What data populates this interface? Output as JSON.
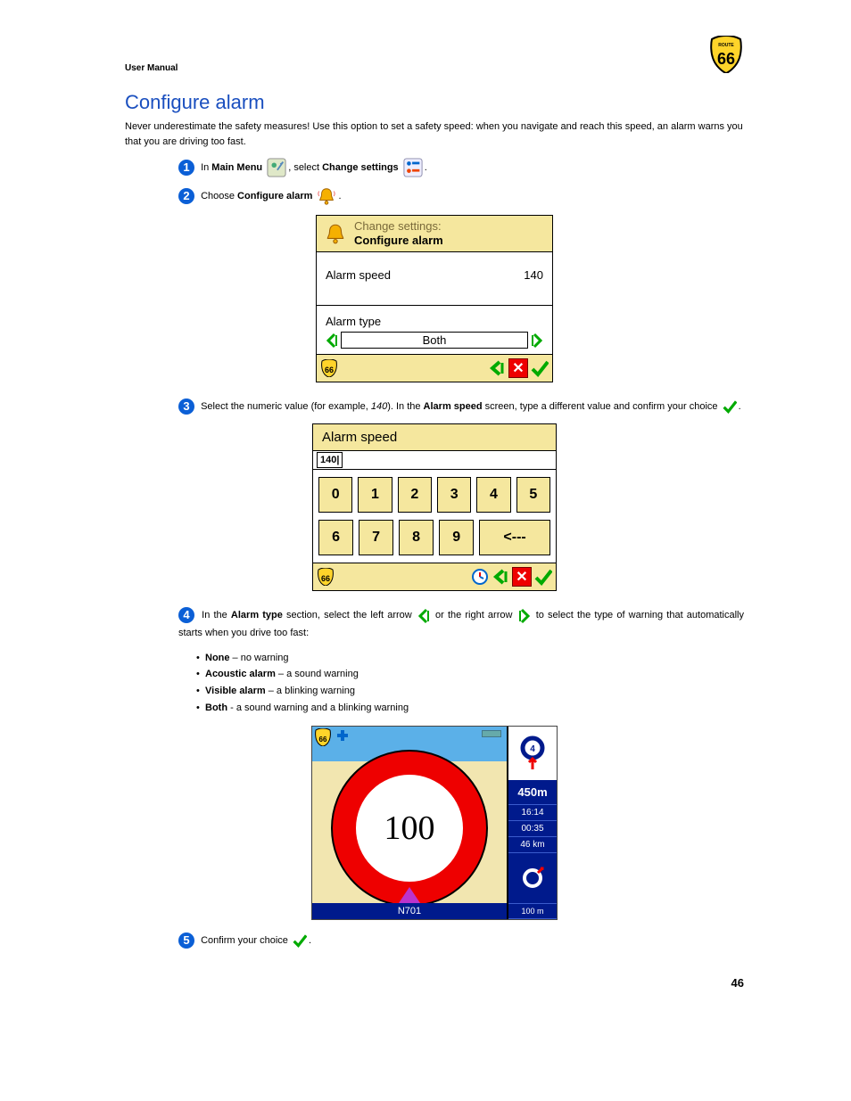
{
  "header": {
    "manual": "User Manual"
  },
  "title": "Configure alarm",
  "intro": "Never underestimate the safety measures! Use this option to set a safety speed: when you navigate and reach this speed, an alarm warns you that you are driving too fast.",
  "steps": {
    "s1": {
      "num": "1",
      "pre": "In ",
      "b1": "Main Menu",
      "mid": ", select ",
      "b2": "Change settings",
      "post": "."
    },
    "s2": {
      "num": "2",
      "pre": "Choose ",
      "b1": "Configure alarm",
      "post": "."
    },
    "s3": {
      "num": "3",
      "pre": "Select the numeric value (for example, ",
      "i1": "140",
      "mid": "). In the ",
      "b1": "Alarm speed",
      "post1": " screen, type a different value and confirm your choice ",
      "post2": "."
    },
    "s4": {
      "num": "4",
      "pre": "In the ",
      "b1": "Alarm type",
      "mid1": " section, select the left arrow ",
      "mid2": " or the right arrow ",
      "post": " to select the type of warning that automatically starts when you drive too fast:"
    },
    "s5": {
      "num": "5",
      "pre": "Confirm your choice ",
      "post": "."
    }
  },
  "bullets": [
    {
      "b": "None",
      "t": " – no warning"
    },
    {
      "b": "Acoustic alarm",
      "t": " – a sound warning"
    },
    {
      "b": "Visible alarm",
      "t": " – a blinking warning"
    },
    {
      "b": "Both",
      "t": " - a sound warning and a blinking warning"
    }
  ],
  "fig1": {
    "titleline1": "Change settings:",
    "titleline2": "Configure alarm",
    "label_speed": "Alarm speed",
    "value_speed": "140",
    "label_type": "Alarm type",
    "value_type": "Both"
  },
  "fig2": {
    "title": "Alarm speed",
    "input": "140|",
    "keys_row1": [
      "0",
      "1",
      "2",
      "3",
      "4",
      "5"
    ],
    "keys_row2": [
      "6",
      "7",
      "8",
      "9"
    ],
    "key_back": "<---"
  },
  "fig3": {
    "speed": "100",
    "road": "N701",
    "dist": "450m",
    "time": "16:14",
    "remain": "00:35",
    "distleft": "46 km",
    "scale": "100 m"
  },
  "page": "46"
}
